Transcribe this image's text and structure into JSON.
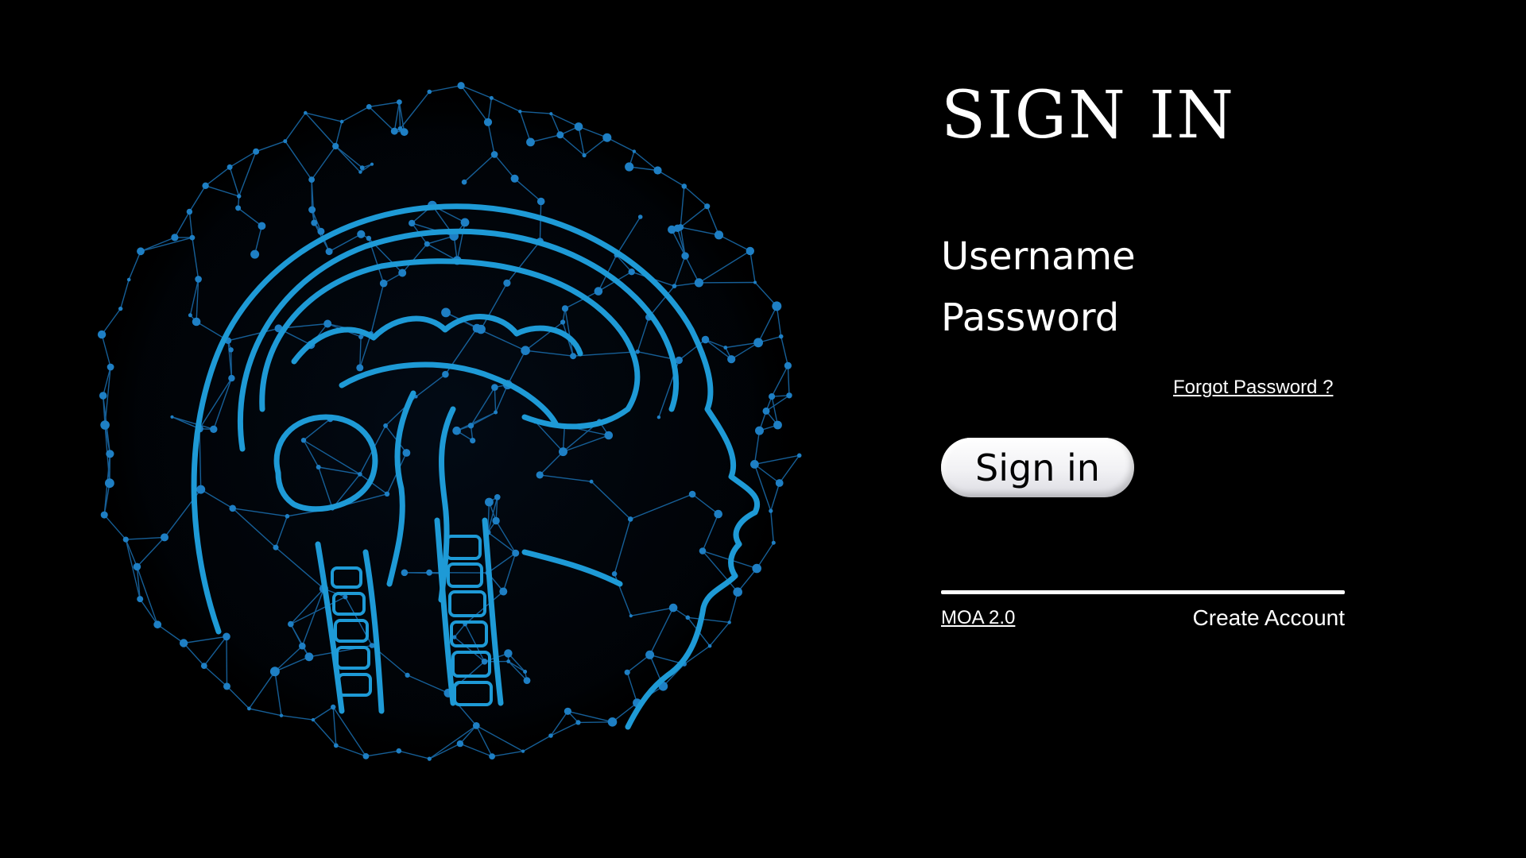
{
  "signin": {
    "title": "SIGN IN",
    "username_placeholder": "Username",
    "password_placeholder": "Password",
    "forgot_label": "Forgot Password ?",
    "submit_label": "Sign in"
  },
  "footer": {
    "brand_label": "MOA 2.0",
    "create_account_label": "Create Account"
  },
  "illustration": {
    "icon": "neural-head-globe-icon"
  },
  "colors": {
    "background": "#000000",
    "text": "#ffffff",
    "accent_blue": "#1e9ad6",
    "network_blue": "#1a6fb0",
    "button_fill": "#f1f1f4"
  }
}
